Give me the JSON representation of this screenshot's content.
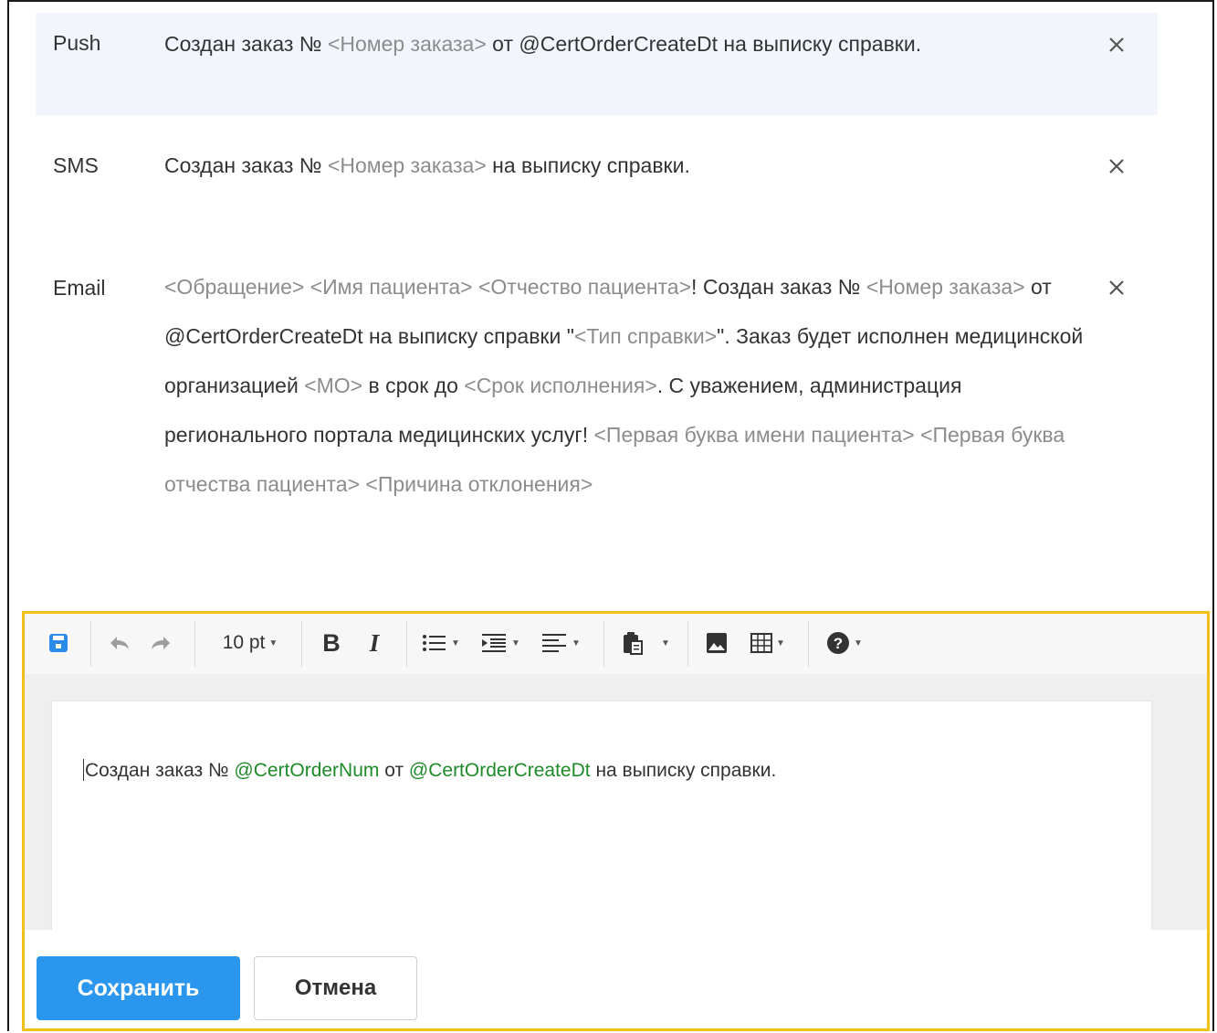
{
  "notifications": [
    {
      "channel": "Push",
      "parts": [
        {
          "t": "Создан заказ № ",
          "ph": false
        },
        {
          "t": "<Номер заказа>",
          "ph": true
        },
        {
          "t": " от @CertOrderCreateDt на выписку справки.",
          "ph": false
        }
      ]
    },
    {
      "channel": "SMS",
      "parts": [
        {
          "t": "Создан заказ № ",
          "ph": false
        },
        {
          "t": "<Номер заказа>",
          "ph": true
        },
        {
          "t": " на выписку справки.",
          "ph": false
        }
      ]
    },
    {
      "channel": "Email",
      "parts": [
        {
          "t": "<Обращение> <Имя пациента> <Отчество пациента>",
          "ph": true
        },
        {
          "t": "! Создан заказ № ",
          "ph": false
        },
        {
          "t": "<Номер заказа>",
          "ph": true
        },
        {
          "t": " от @CertOrderCreateDt на выписку справки \"",
          "ph": false
        },
        {
          "t": "<Тип справки>",
          "ph": true
        },
        {
          "t": "\". Заказ будет исполнен медицинской организацией ",
          "ph": false
        },
        {
          "t": "<МО>",
          "ph": true
        },
        {
          "t": " в срок до ",
          "ph": false
        },
        {
          "t": "<Срок исполнения>",
          "ph": true
        },
        {
          "t": ". С уважением, администрация регионального портала медицинских услуг! ",
          "ph": false
        },
        {
          "t": "<Первая буква имени пациента> <Первая буква отчества пациента> <Причина отклонения>",
          "ph": true
        }
      ]
    }
  ],
  "editor": {
    "font_size": "10 pt",
    "content": {
      "t1": "Создан заказ № ",
      "v1": "@CertOrderNum",
      "t2": " от ",
      "v2": "@CertOrderCreateDt",
      "t3": " на выписку справки."
    }
  },
  "buttons": {
    "save": "Сохранить",
    "cancel": "Отмена"
  },
  "colors": {
    "placeholder": "#8c8c8c",
    "variable": "#1f8a2a",
    "primary": "#2a96ee",
    "highlight_border": "#f2c118"
  }
}
